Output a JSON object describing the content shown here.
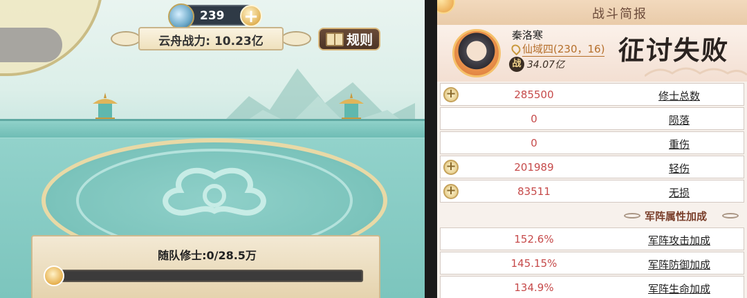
{
  "left": {
    "resource": {
      "value": "239",
      "icon": "spirit-crystal-icon",
      "plus_icon": "plus-icon"
    },
    "power": {
      "label": "云舟战力:",
      "value": "10.23亿"
    },
    "rules": {
      "label": "规则",
      "icon": "book-icon"
    },
    "followers": {
      "label": "随队修士:0/28.5万",
      "progress": 0.0
    }
  },
  "right": {
    "title": "战斗简报",
    "hero": {
      "name": "秦洛寒",
      "location": "仙域四(230，16)",
      "war_badge": "战",
      "power": "34.07亿",
      "result": "征讨失败"
    },
    "stats": [
      {
        "value": "285500",
        "label": "修士总数",
        "expandable": true
      },
      {
        "value": "0",
        "label": "陨落",
        "expandable": false
      },
      {
        "value": "0",
        "label": "重伤",
        "expandable": false
      },
      {
        "value": "201989",
        "label": "轻伤",
        "expandable": true
      },
      {
        "value": "83511",
        "label": "无损",
        "expandable": true
      }
    ],
    "section_title": "军阵属性加成",
    "bonuses": [
      {
        "value": "152.6%",
        "label": "军阵攻击加成"
      },
      {
        "value": "145.15%",
        "label": "军阵防御加成"
      },
      {
        "value": "134.9%",
        "label": "军阵生命加成"
      }
    ]
  },
  "colors": {
    "value_red": "#c64a4a",
    "accent_gold": "#d7b35a",
    "panel_bg": "#f7f1ec"
  }
}
